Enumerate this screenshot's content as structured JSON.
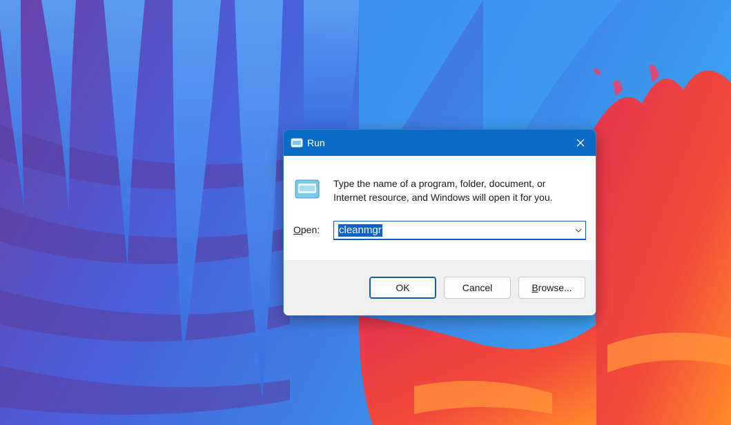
{
  "window": {
    "title": "Run",
    "close_glyph": "✕"
  },
  "description": {
    "line1": "Type the name of a program, folder, document, or",
    "line2": "Internet resource, and Windows will open it for you."
  },
  "open_field": {
    "label_accel": "O",
    "label_rest": "pen:",
    "value": "cleanmgr"
  },
  "buttons": {
    "ok": "OK",
    "cancel": "Cancel",
    "browse_accel": "B",
    "browse_rest": "rowse..."
  },
  "icons": {
    "title": "run-app-icon",
    "app": "run-app-icon",
    "dropdown": "chevron-down-icon",
    "close": "close-icon"
  },
  "colors": {
    "titlebar": "#0a6bc7",
    "selection": "#0a64c8"
  }
}
